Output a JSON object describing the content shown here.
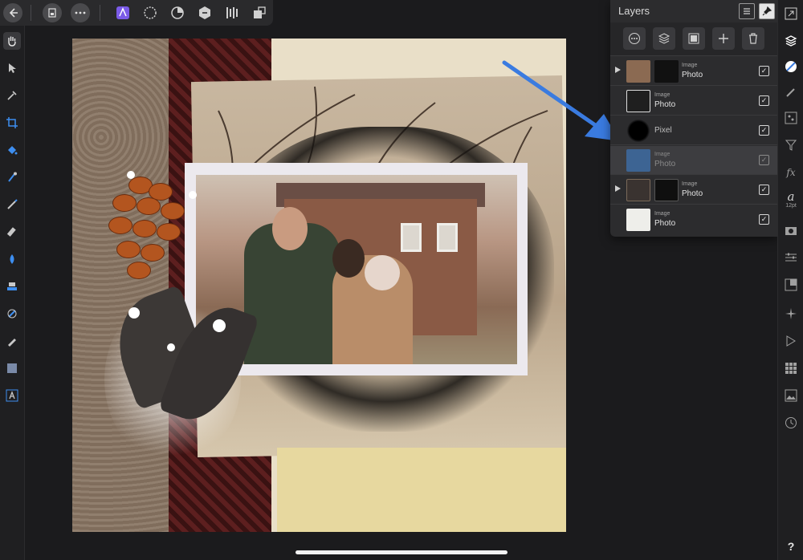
{
  "toolbar": {
    "back_icon": "back-arrow-icon",
    "document_icon": "document-icon",
    "more_icon": "more-icon",
    "personas": [
      "designer-persona-icon",
      "pixel-persona-icon",
      "photo-persona-icon",
      "export-persona-icon",
      "align-icon",
      "arrange-icon"
    ]
  },
  "left_tools": [
    "hand-icon",
    "move-icon",
    "color-picker-icon",
    "crop-icon",
    "fill-icon",
    "flood-select-icon",
    "paint-brush-icon",
    "erase-brush-icon",
    "dodge-burn-icon",
    "clone-icon",
    "healing-icon",
    "pen-icon",
    "rectangle-shape-icon",
    "text-frame-icon"
  ],
  "right_tools": {
    "items": [
      "navigator-icon",
      "layers-icon",
      "color-icon",
      "brush-icon",
      "channels-icon",
      "filter-icon",
      "fx-icon",
      "text-style-icon",
      "camera-icon",
      "adjustments-icon",
      "transform-icon",
      "snap-icon",
      "play-icon",
      "grid-icon",
      "image-icon",
      "history-icon",
      "help-icon"
    ],
    "text_size": "12pt",
    "help_label": "?"
  },
  "layers_panel": {
    "title": "Layers",
    "rows": [
      {
        "type": "Image",
        "name": "Photo",
        "expandable": true,
        "visible": true
      },
      {
        "type": "Image",
        "name": "Photo",
        "expandable": false,
        "visible": true
      },
      {
        "type": "",
        "name": "Pixel",
        "expandable": false,
        "visible": true
      },
      {
        "type": "Image",
        "name": "Photo",
        "expandable": false,
        "visible": true,
        "dragging": true
      },
      {
        "type": "Image",
        "name": "Photo",
        "expandable": true,
        "visible": true
      },
      {
        "type": "Image",
        "name": "Photo",
        "expandable": false,
        "visible": true
      }
    ]
  },
  "colors": {
    "accent_arrow": "#3a7be0",
    "panel_bg": "#2c2c2e",
    "persona_active": "#7b5be8"
  }
}
